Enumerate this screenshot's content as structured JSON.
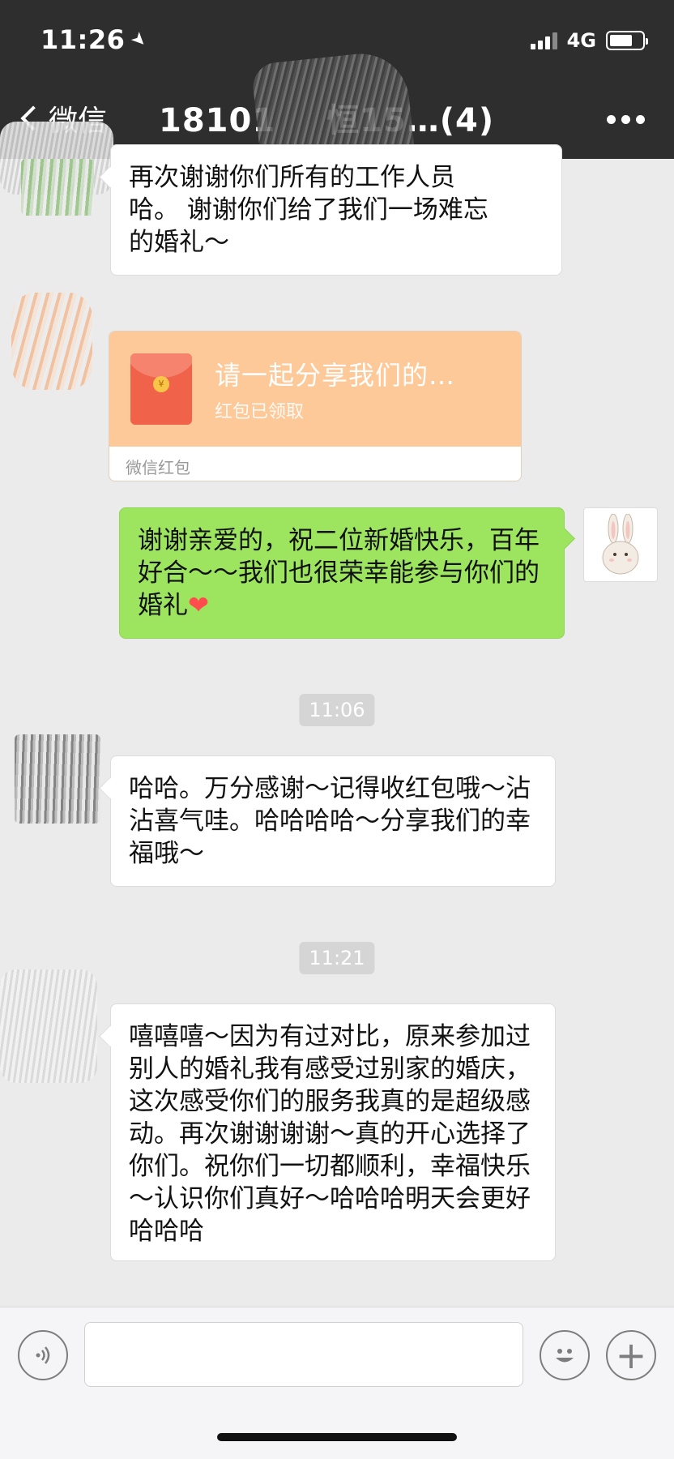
{
  "status_bar": {
    "time": "11:26",
    "network": "4G"
  },
  "nav": {
    "back_label": "微信",
    "title": "18101       恒15…(4)"
  },
  "messages": [
    {
      "side": "left",
      "text_lines": [
        "再次谢谢你们所有的工作人员",
        "哈。 谢谢你们给了我们一场难忘",
        "的婚礼～"
      ]
    },
    {
      "side": "right",
      "text": "谢谢亲爱的，祝二位新婚快乐，百年好合～～我们也很荣幸能参与你们的婚礼",
      "emoji": "❤"
    },
    {
      "side": "left",
      "text": "哈哈。万分感谢～记得收红包哦～沾沾喜气哇。哈哈哈哈～分享我们的幸福哦～"
    },
    {
      "side": "left",
      "text": "嘻嘻嘻～因为有过对比，原来参加过别人的婚礼我有感受过别家的婚庆，这次感受你们的服务我真的是超级感动。再次谢谢谢谢～真的开心选择了你们。祝你们一切都顺利，幸福快乐～认识你们真好～哈哈哈明天会更好哈哈哈"
    }
  ],
  "red_packet": {
    "title": "请一起分享我们的…",
    "status": "红包已领取",
    "footer": "微信红包",
    "coin_glyph": "¥"
  },
  "timestamps": [
    "11:06",
    "11:21"
  ],
  "input": {
    "value": "",
    "placeholder": ""
  },
  "colors": {
    "header_bg": "#2e2e2f",
    "sent_bubble": "#9ee55f",
    "red_packet_bg": "#fdc998",
    "chat_bg": "#ebebeb"
  }
}
